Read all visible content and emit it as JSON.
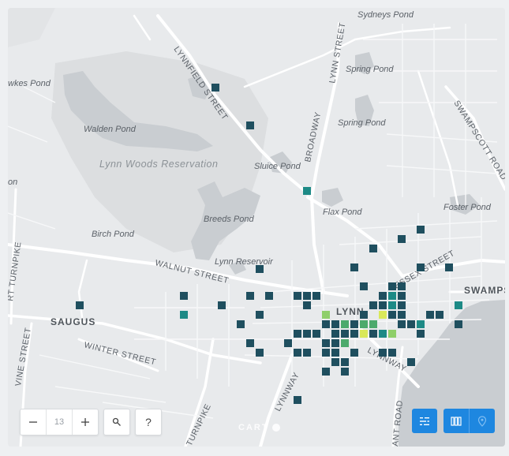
{
  "map": {
    "labels": {
      "sydneys_pond": "Sydneys Pond",
      "lynnfield_street": "LYNNFIELD STREET",
      "lynn_street": "LYNN STREET",
      "spring_pond_1": "Spring Pond",
      "spring_pond_2": "Spring Pond",
      "wakes_pond": "wkes Pond",
      "walden_pond": "Walden Pond",
      "swampscott_road": "SWAMPSCOTT ROAD",
      "lynn_woods": "Lynn Woods Reservation",
      "broadway": "BROADWAY",
      "sluice_pond": "Sluice Pond",
      "on_fragment": "on",
      "breeds_pond": "Breeds Pond",
      "flax_pond": "Flax Pond",
      "foster_pond": "Foster Pond",
      "birch_pond": "Birch Pond",
      "turnpike_left": "RT TURNPIKE",
      "walnut_street": "WALNUT STREET",
      "lynn_reservoir": "Lynn Reservoir",
      "essex_street": "ESSEX STREET",
      "lynn": "LYNN",
      "swamps": "SWAMPS",
      "saugus": "SAUGUS",
      "vine_street": "VINE STREET",
      "winter_street": "WINTER STREET",
      "lynnway_1": "LYNNWAY",
      "lynnway_2": "LYNNWAY",
      "ant_road": "ANT ROAD",
      "turnpike_bottom": "TURNPIKE"
    },
    "attribution": "CART",
    "colors": {
      "cell_dark": "#1f4f5f",
      "cell_teal": "#1d8a86",
      "cell_green": "#4caa6c",
      "cell_lightgreen": "#8fcf6a",
      "cell_yellow": "#d9e85a",
      "water": "#cfd3d6",
      "forest": "#dfe1e3",
      "accent": "#1e87e0"
    }
  },
  "controls": {
    "zoom_out_icon": "minus-icon",
    "zoom_level": "13",
    "zoom_in_icon": "plus-icon",
    "search_icon": "search-icon",
    "help_label": "?",
    "layers_icon": "layers-icon",
    "columns_icon": "columns-icon",
    "pin_icon": "map-pin-icon"
  }
}
